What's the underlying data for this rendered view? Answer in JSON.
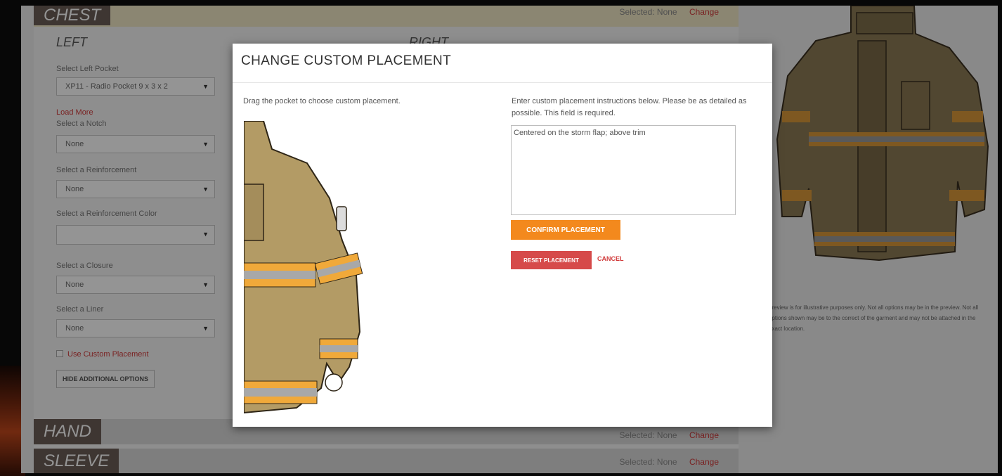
{
  "sections": {
    "chest": {
      "title": "CHEST",
      "selected_text": "Selected: None",
      "change_label": "Change"
    },
    "hand": {
      "title": "HAND",
      "selected_text": "Selected: None",
      "change_label": "Change"
    },
    "sleeve": {
      "title": "SLEEVE",
      "selected_text": "Selected: None",
      "change_label": "Change"
    }
  },
  "columns": {
    "left": "LEFT",
    "right": "RIGHT"
  },
  "form": {
    "pocket_label": "Select Left Pocket",
    "pocket_value": "XP11 - Radio Pocket 9 x 3 x 2",
    "load_more": "Load More",
    "notch_label": "Select a Notch",
    "notch_value": "None",
    "reinforcement_label": "Select a Reinforcement",
    "reinforcement_value": "None",
    "reinforcement_color_label": "Select a Reinforcement Color",
    "reinforcement_color_value": "",
    "closure_label": "Select a Closure",
    "closure_value": "None",
    "liner_label": "Select a Liner",
    "liner_value": "None",
    "custom_placement_label": "Use Custom Placement",
    "hide_options_label": "HIDE ADDITIONAL OPTIONS"
  },
  "preview_note": "preview is for illustrative purposes only. Not all options may be in the preview. Not all options shown may be to the correct of the garment and may not be attached in the exact location.",
  "modal": {
    "title": "CHANGE CUSTOM PLACEMENT",
    "drag_instruction": "Drag the pocket to choose custom placement.",
    "instructions": "Enter custom placement instructions below. Please be as detailed as possible. This field is required.",
    "textarea_value": "Centered on the storm flap; above trim",
    "confirm_label": "CONFIRM PLACEMENT",
    "reset_label": "RESET PLACEMENT",
    "cancel_label": "CANCEL"
  },
  "colors": {
    "accent_orange": "#f3891d",
    "danger_red": "#d64a4a",
    "section_title_bg": "#6b5e57",
    "jacket_tan": "#a8925e",
    "trim_yellow": "#f0a93a"
  }
}
